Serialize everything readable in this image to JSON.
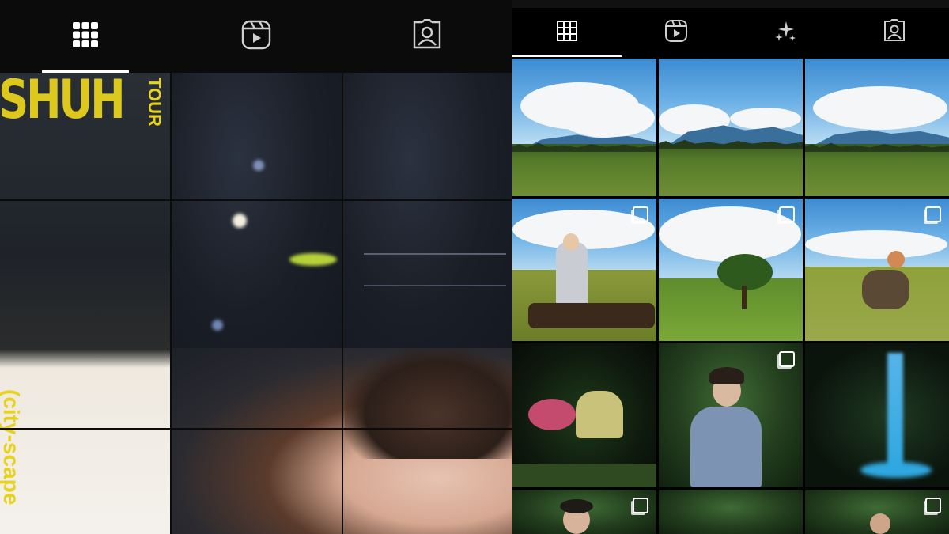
{
  "left_panel": {
    "tabs": [
      {
        "icon": "grid-icon",
        "active": true
      },
      {
        "icon": "reels-icon",
        "active": false
      },
      {
        "icon": "tagged-icon",
        "active": false
      }
    ],
    "poster": {
      "main_text": "SHUH",
      "side_text": "TOUR",
      "bottom_text": "(city-scape"
    }
  },
  "right_panel": {
    "tabs": [
      {
        "icon": "grid-icon",
        "active": true
      },
      {
        "icon": "reels-icon",
        "active": false
      },
      {
        "icon": "sparkles-icon",
        "active": false
      },
      {
        "icon": "tagged-icon",
        "active": false
      }
    ],
    "posts": [
      {
        "row": 1,
        "col": 1,
        "scene": "sky-landscape",
        "multiple": false
      },
      {
        "row": 1,
        "col": 2,
        "scene": "sky-landscape",
        "multiple": false
      },
      {
        "row": 1,
        "col": 3,
        "scene": "sky-landscape",
        "multiple": false
      },
      {
        "row": 2,
        "col": 1,
        "scene": "person-sitting-field",
        "multiple": true
      },
      {
        "row": 2,
        "col": 2,
        "scene": "tree-field",
        "multiple": true
      },
      {
        "row": 2,
        "col": 3,
        "scene": "person-sitting-field",
        "multiple": true
      },
      {
        "row": 3,
        "col": 1,
        "scene": "night-plant",
        "multiple": false
      },
      {
        "row": 3,
        "col": 2,
        "scene": "person-forest",
        "multiple": true
      },
      {
        "row": 3,
        "col": 3,
        "scene": "waterfall-night",
        "multiple": false
      },
      {
        "row": 4,
        "col": 1,
        "scene": "person-forest",
        "multiple": true
      },
      {
        "row": 4,
        "col": 2,
        "scene": "forest",
        "multiple": false
      },
      {
        "row": 4,
        "col": 3,
        "scene": "person-forest",
        "multiple": true
      }
    ]
  },
  "colors": {
    "accent_yellow": "#e7d21c",
    "tab_active": "#ffffff",
    "tab_inactive": "#cfcfcf",
    "background": "#000000"
  }
}
